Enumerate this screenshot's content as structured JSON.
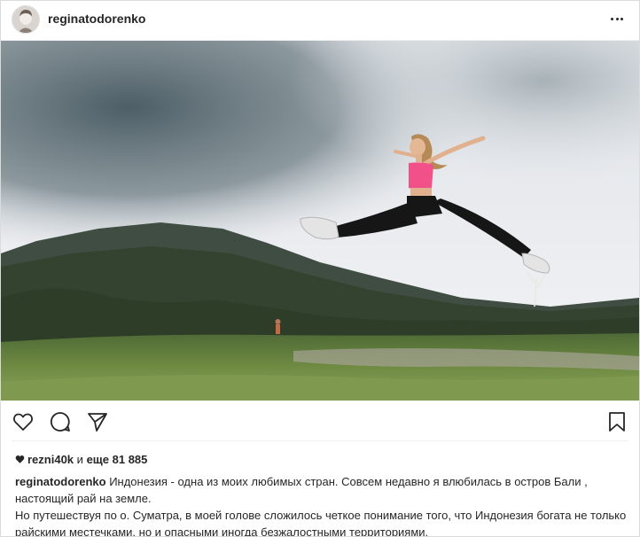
{
  "post": {
    "username": "reginatodorenko",
    "likes": {
      "heart_icon": "heart-filled-icon",
      "liker": "rezni40k",
      "connector": "и",
      "others_prefix": "еще",
      "others_count": "81 885"
    },
    "caption": {
      "user": "reginatodorenko",
      "line1": "Индонезия - одна из моих любимых стран. Совсем недавно я влюбилась в остров Бали , настоящий рай на земле.",
      "line2": "Но путешествуя по о. Суматра,  в моей голове сложилось четкое понимание того, что Индонезия богата не только райскими местечками, но и опасными иногда безжалостными территориями."
    },
    "icons": {
      "more": "more-options-icon",
      "like": "heart-outline-icon",
      "comment": "comment-bubble-icon",
      "share": "paper-plane-icon",
      "save": "bookmark-icon"
    }
  },
  "colors": {
    "text": "#262626",
    "border": "#dbdbdb",
    "sky": "#e9ebef",
    "cloud_dark": "#5f6f77",
    "mountain": "#3d4b3f",
    "grass": "#6f8a3c",
    "top_pink": "#f0508a",
    "leggings": "#151515"
  }
}
